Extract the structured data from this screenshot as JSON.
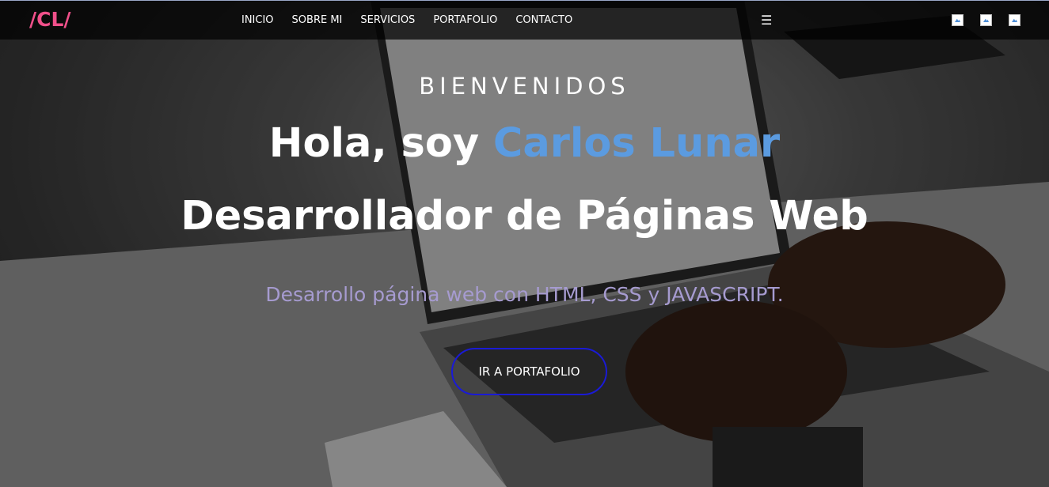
{
  "nav": {
    "logo": "/CL/",
    "links": [
      "INICIO",
      "SOBRE MI",
      "SERVICIOS",
      "PORTAFOLIO",
      "CONTACTO"
    ],
    "menu_icon": "hamburger-icon",
    "social_icons": [
      "broken-image-icon",
      "broken-image-icon",
      "broken-image-icon"
    ]
  },
  "hero": {
    "welcome": "BIENVENIDOS",
    "greeting_prefix": "Hola, soy ",
    "name": "Carlos Lunar",
    "role": "Desarrollador de Páginas Web",
    "tagline": "Desarrollo página web con HTML, CSS y JAVASCRIPT.",
    "cta_label": "IR A PORTAFOLIO"
  },
  "colors": {
    "logo": "#f0508a",
    "name_accent": "#5b9be0",
    "tagline": "#a69bd0",
    "button_border": "#1a1ad6"
  }
}
